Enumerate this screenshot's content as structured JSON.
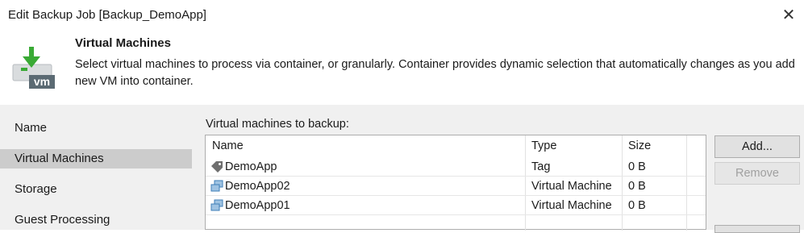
{
  "window": {
    "title": "Edit Backup Job [Backup_DemoApp]",
    "close_glyph": "✕"
  },
  "header": {
    "step_title": "Virtual Machines",
    "description": "Select virtual machines to process via container, or granularly. Container provides dynamic selection that automatically changes as you add new VM into container.",
    "icon": "vm-download-icon",
    "icon_text": "vm"
  },
  "steps": [
    "Name",
    "Virtual Machines",
    "Storage",
    "Guest Processing"
  ],
  "selected_step": "Virtual Machines",
  "vm_list": {
    "label": "Virtual machines to backup:",
    "columns": [
      "Name",
      "Type",
      "Size"
    ],
    "rows": [
      {
        "name": "DemoApp",
        "type": "Tag",
        "size": "0 B",
        "icon": "tag-icon"
      },
      {
        "name": "DemoApp02",
        "type": "Virtual Machine",
        "size": "0 B",
        "icon": "vm-icon"
      },
      {
        "name": "DemoApp01",
        "type": "Virtual Machine",
        "size": "0 B",
        "icon": "vm-icon"
      }
    ]
  },
  "buttons": {
    "add": "Add...",
    "remove": "Remove"
  },
  "colors": {
    "selected_step_bg": "#cccccc",
    "panel_bg": "#f0f0f0",
    "icon_green": "#3aaa35",
    "icon_vm_bg": "#5b6a73"
  }
}
